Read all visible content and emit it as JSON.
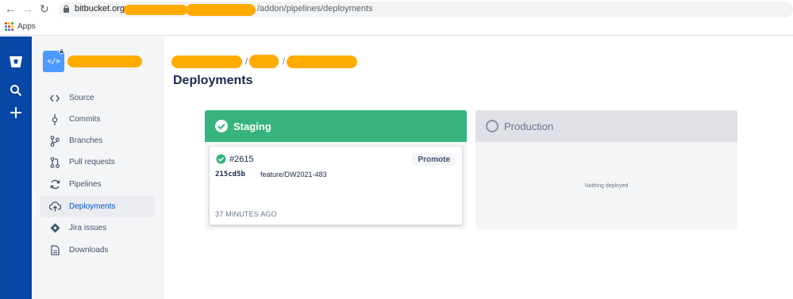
{
  "browser": {
    "url_host": "bitbucket.org",
    "url_path": "/addon/pipelines/deployments",
    "bookmark_apps": "Apps",
    "apps_colors": [
      "#ea4335",
      "#fbbc05",
      "#34a853",
      "#4285f4",
      "#ea4335",
      "#fbbc05",
      "#34a853",
      "#4285f4",
      "#ea4335"
    ]
  },
  "global_nav": {
    "icons": [
      "bitbucket-logo-icon",
      "search-icon",
      "create-plus-icon"
    ]
  },
  "repo": {
    "avatar_glyph": "</>"
  },
  "sidebar": {
    "items": [
      {
        "label": "Source",
        "icon": "code-icon"
      },
      {
        "label": "Commits",
        "icon": "commit-icon"
      },
      {
        "label": "Branches",
        "icon": "branch-icon"
      },
      {
        "label": "Pull requests",
        "icon": "pull-request-icon"
      },
      {
        "label": "Pipelines",
        "icon": "pipelines-icon"
      },
      {
        "label": "Deployments",
        "icon": "deployments-icon",
        "active": true
      },
      {
        "label": "Jira issues",
        "icon": "jira-icon"
      },
      {
        "label": "Downloads",
        "icon": "downloads-icon"
      }
    ]
  },
  "breadcrumb": {
    "separator": "/"
  },
  "page": {
    "title": "Deployments"
  },
  "environments": {
    "staging": {
      "name": "Staging",
      "deployment": {
        "build": "#2615",
        "promote_label": "Promote",
        "commit_hash": "215cd5b",
        "branch": "feature/DW2021-483",
        "time": "37 MINUTES AGO"
      }
    },
    "production": {
      "name": "Production",
      "empty_text": "Nothing deployed"
    }
  },
  "colors": {
    "global_nav": "#0747a6",
    "staging_header": "#36b37e",
    "active_link": "#0052cc",
    "redaction": "#ffab00"
  }
}
